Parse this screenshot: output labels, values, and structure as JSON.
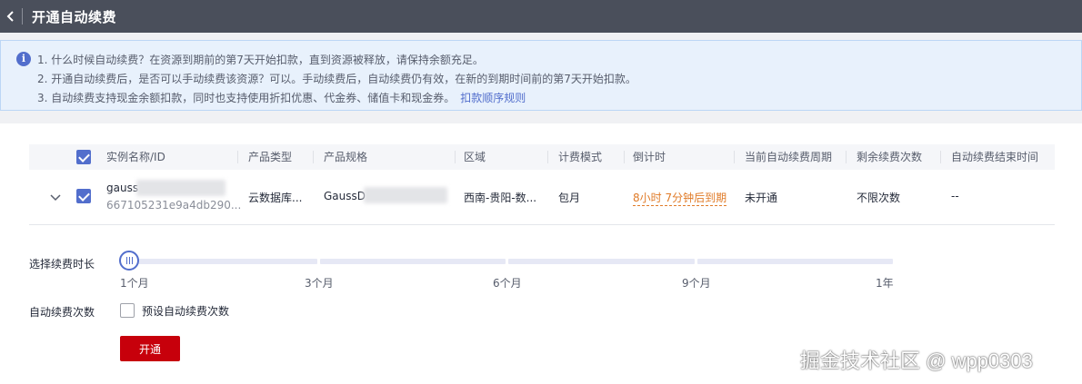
{
  "header": {
    "title": "开通自动续费"
  },
  "notice": {
    "line1": "1. 什么时候自动续费？在资源到期前的第7天开始扣款，直到资源被释放，请保持余额充足。",
    "line2": "2. 开通自动续费后，是否可以手动续费该资源？可以。手动续费后，自动续费仍有效，在新的到期时间前的第7天开始扣款。",
    "line3": "3. 自动续费支持现金余额扣款，同时也支持使用折扣优惠、代金券、储值卡和现金券。",
    "link": "扣款顺序规则"
  },
  "table": {
    "columns": [
      "实例名称/ID",
      "产品类型",
      "产品规格",
      "区域",
      "计费模式",
      "倒计时",
      "当前自动续费周期",
      "剩余续费次数",
      "自动续费结束时间"
    ],
    "rows": [
      {
        "name": "gauss",
        "id": "667105231e9a4db290...",
        "product_type": "云数据库...",
        "spec": "GaussD",
        "region": "西南-贵阳-数...",
        "billing": "包月",
        "countdown": "8小时 7分钟后到期",
        "cycle": "未开通",
        "remaining": "不限次数",
        "end_time": "--",
        "selected": true
      }
    ]
  },
  "duration": {
    "label": "选择续费时长",
    "ticks": [
      "1个月",
      "3个月",
      "6个月",
      "9个月",
      "1年"
    ],
    "selected": "1个月"
  },
  "renew_count": {
    "label": "自动续费次数",
    "checkbox_label": "预设自动续费次数",
    "checked": false
  },
  "submit_label": "开通",
  "watermark": "掘金技术社区 @ wpp0303",
  "colors": {
    "accent": "#526ecc",
    "primary_button": "#c7000b",
    "countdown": "#e07b28",
    "header_bg": "#4a4f5b"
  }
}
